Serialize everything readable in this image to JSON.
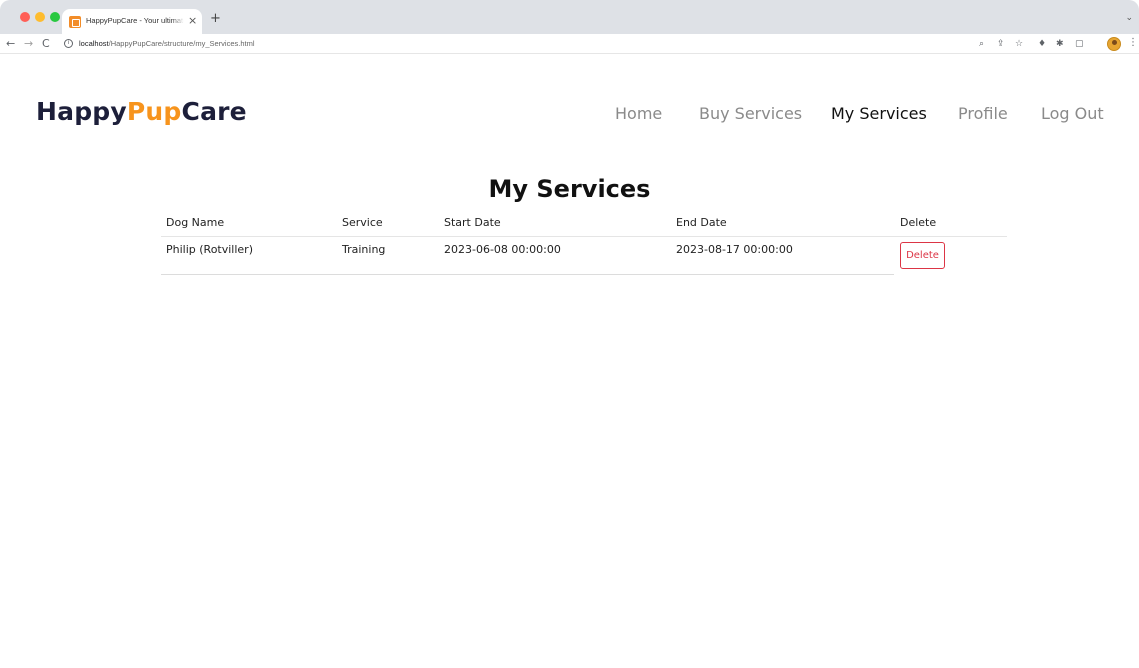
{
  "browser": {
    "tab_title": "HappyPupCare - Your ultimate",
    "tab_close": "×",
    "new_tab": "+",
    "url_host": "localhost",
    "url_path": "/HappyPupCare/structure/my_Services.html",
    "back": "←",
    "forward": "→",
    "reload": "C",
    "info": "i",
    "zoom_icon": "⌕",
    "share_icon": "⇪",
    "star_icon": "☆",
    "ext1_icon": "♦",
    "ext2_icon": "✱",
    "sidepanel_icon": "▢",
    "menu_icon": "⋮",
    "tab_menu_icon": "⌄"
  },
  "brand": {
    "part1": "Happy",
    "part2": "Pup",
    "part3": "Care",
    "color_dark": "#1d1f3a",
    "color_accent": "#f7941d"
  },
  "nav": {
    "home": "Home",
    "buy_services": "Buy Services",
    "my_services": "My Services",
    "profile": "Profile",
    "log_out": "Log Out",
    "active": "My Services"
  },
  "page": {
    "title": "My Services"
  },
  "table": {
    "headers": [
      "Dog Name",
      "Service",
      "Start Date",
      "End Date",
      "Delete"
    ],
    "rows": [
      {
        "dog_name": "Philip (Rotviller)",
        "service": "Training",
        "start_date": "2023-06-08 00:00:00",
        "end_date": "2023-08-17 00:00:00",
        "delete_label": "Delete"
      }
    ]
  },
  "colors": {
    "danger": "#dc3545",
    "nav_inactive": "#8a8a8a",
    "nav_active": "#111111"
  }
}
